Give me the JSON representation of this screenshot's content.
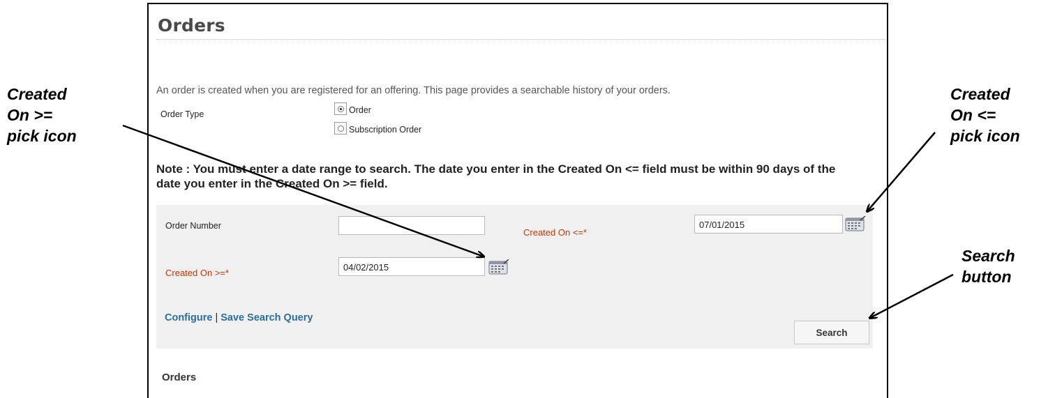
{
  "page": {
    "title": "Orders",
    "intro": "An order is created when you are registered for an offering. This page provides a searchable history of your orders."
  },
  "order_type": {
    "label": "Order Type",
    "options": [
      {
        "label": "Order",
        "selected": true
      },
      {
        "label": "Subscription Order",
        "selected": false
      }
    ]
  },
  "note": "Note : You must enter a date range to search. The date you enter in the Created On <= field must be within 90 days of the date you enter in the Created On >= field.",
  "search_form": {
    "order_number_label": "Order Number",
    "order_number_value": "",
    "created_on_le_label": "Created On <=*",
    "created_on_le_value": "07/01/2015",
    "created_on_ge_label": "Created On >=*",
    "created_on_ge_value": "04/02/2015",
    "calendar_icon": "calendar-icon",
    "configure_link": "Configure",
    "link_separator": "|",
    "save_query_link": "Save Search Query",
    "search_button": "Search",
    "required_color": "#cc3300",
    "link_color": "#2a6d9e"
  },
  "results": {
    "heading": "Orders"
  },
  "annotations": {
    "created_on_ge_pick": [
      "Created",
      "On >=",
      "pick icon"
    ],
    "created_on_le_pick": [
      "Created",
      "On <=",
      "pick icon"
    ],
    "search_button": [
      "Search",
      "button"
    ]
  }
}
